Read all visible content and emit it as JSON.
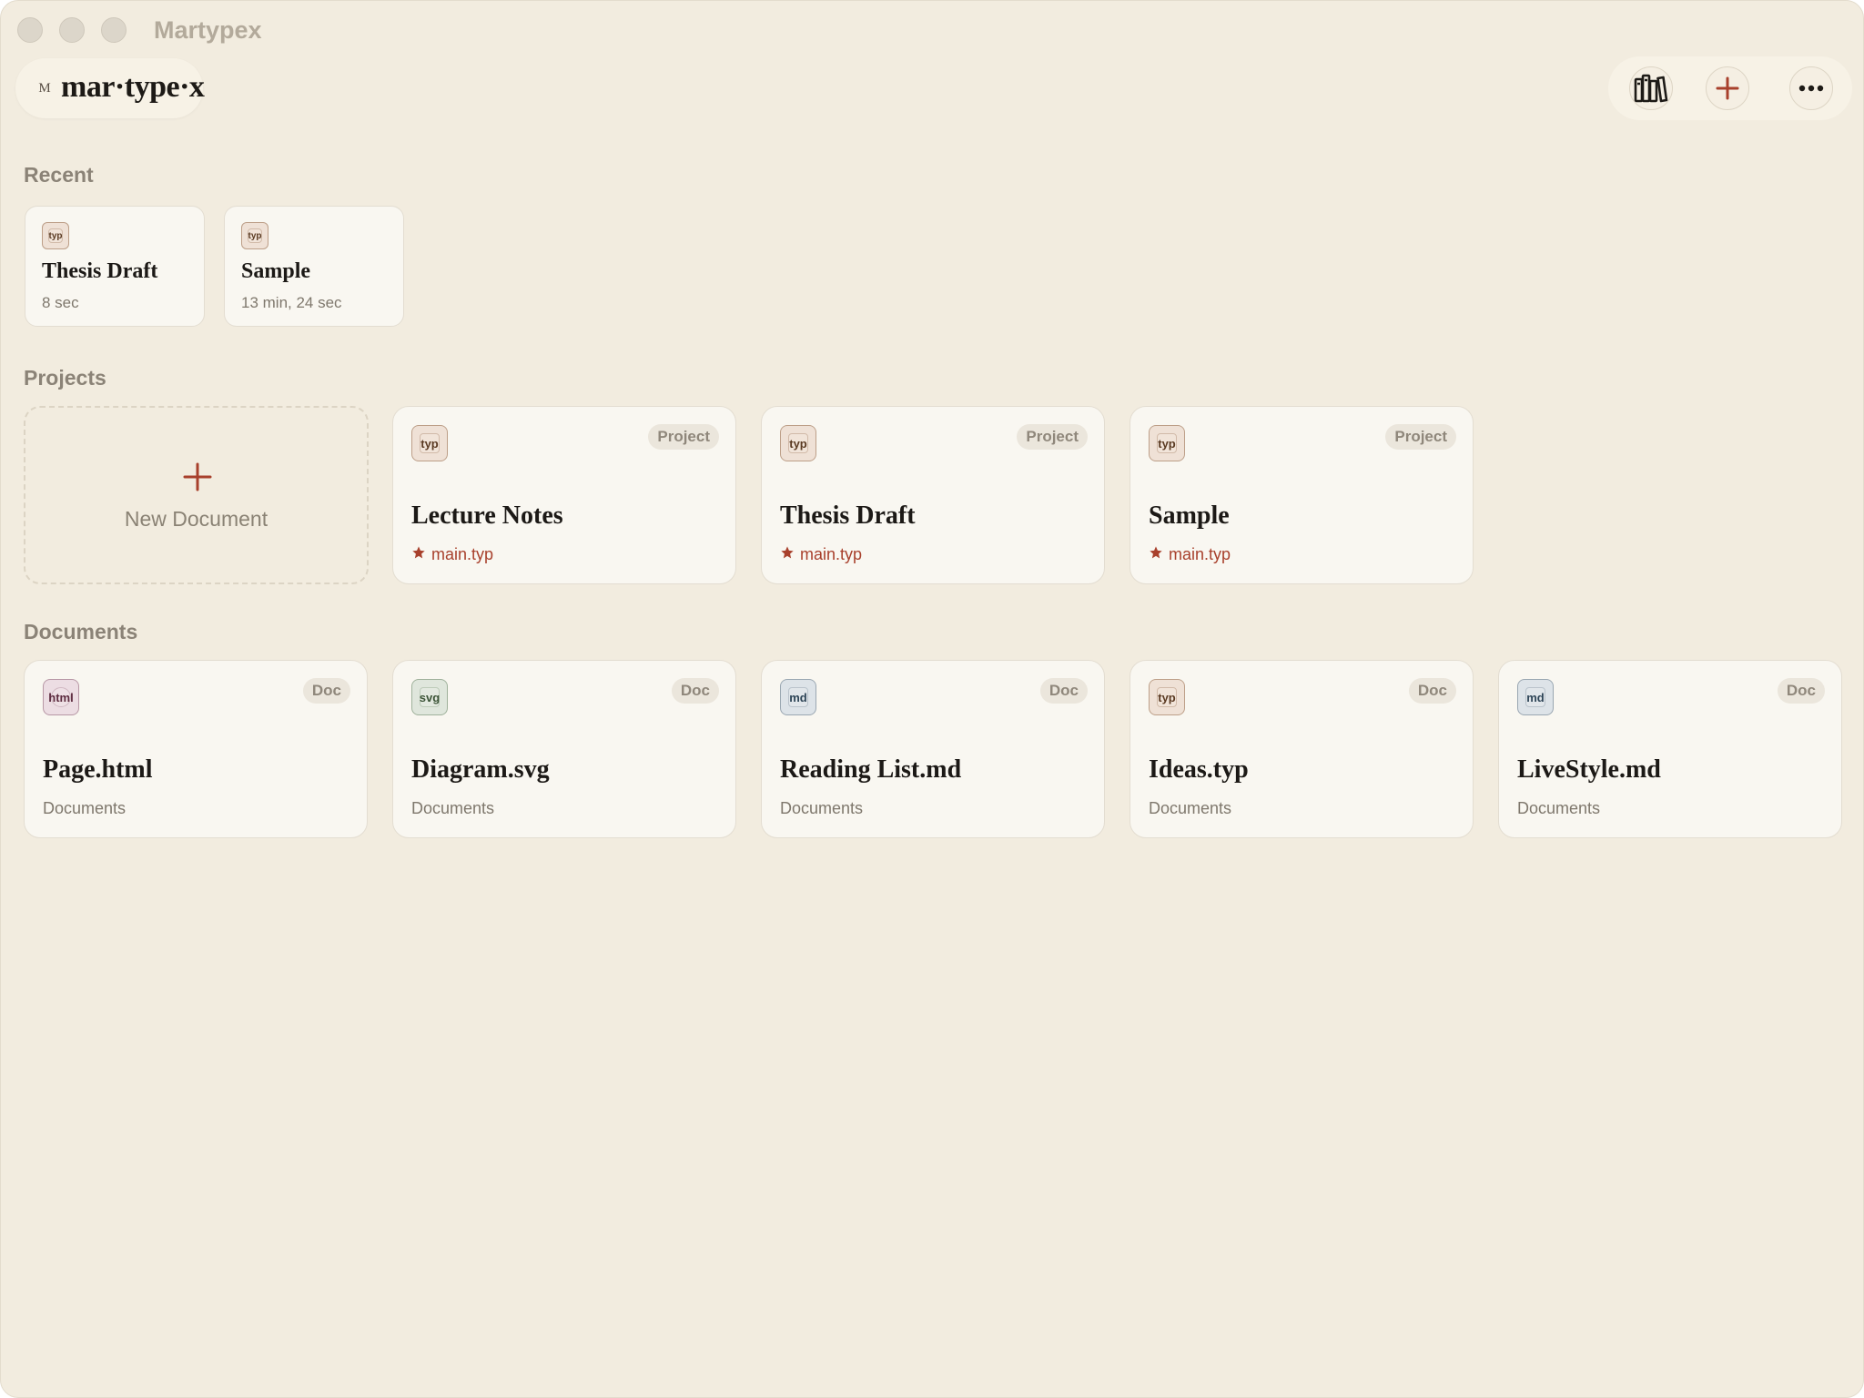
{
  "window": {
    "title": "Martypex"
  },
  "brand": {
    "mark": "M",
    "name": "mar·type·x"
  },
  "toolbar": {
    "library_icon": "library-books-icon",
    "add_icon": "plus-icon",
    "more_icon": "ellipsis-icon"
  },
  "sections": {
    "recent": "Recent",
    "projects": "Projects",
    "documents": "Documents"
  },
  "recent": [
    {
      "name": "Thesis Draft",
      "meta": "8 sec",
      "type": "typ"
    },
    {
      "name": "Sample",
      "meta": "13 min, 24 sec",
      "type": "typ"
    }
  ],
  "new_document": {
    "label": "New Document"
  },
  "projects": [
    {
      "name": "Lecture Notes",
      "badge": "Project",
      "entry": "main.typ",
      "type": "typ"
    },
    {
      "name": "Thesis Draft",
      "badge": "Project",
      "entry": "main.typ",
      "type": "typ"
    },
    {
      "name": "Sample",
      "badge": "Project",
      "entry": "main.typ",
      "type": "typ"
    }
  ],
  "documents": [
    {
      "name": "Page.html",
      "badge": "Doc",
      "folder": "Documents",
      "type": "html"
    },
    {
      "name": "Diagram.svg",
      "badge": "Doc",
      "folder": "Documents",
      "type": "svg"
    },
    {
      "name": "Reading List.md",
      "badge": "Doc",
      "folder": "Documents",
      "type": "md"
    },
    {
      "name": "Ideas.typ",
      "badge": "Doc",
      "folder": "Documents",
      "type": "typ"
    },
    {
      "name": "LiveStyle.md",
      "badge": "Doc",
      "folder": "Documents",
      "type": "md"
    }
  ],
  "colors": {
    "background": "#f2ecdf",
    "card": "#f9f7f1",
    "accent": "#a8402c"
  }
}
